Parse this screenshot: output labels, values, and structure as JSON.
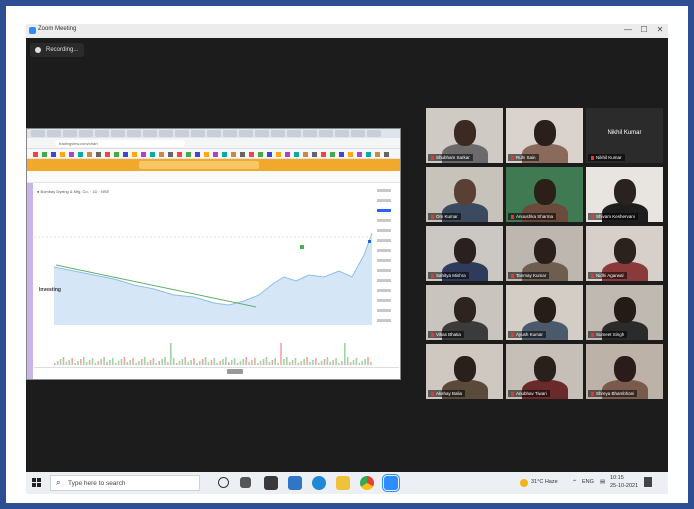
{
  "window": {
    "title": "Zoom Meeting",
    "min": "—",
    "max": "☐",
    "close": "✕"
  },
  "recording": {
    "label": "Recording..."
  },
  "share": {
    "url": "tradingview.com/chart",
    "symbol": "● Bombay Dyeing & Mfg. Co. · 1D · NSE",
    "watermark": "Investing"
  },
  "participants": [
    {
      "name": "Shubham Sarkar",
      "head": "#3a2a22",
      "bg": "#cfcac4",
      "body": "#6b6b6b"
    },
    {
      "name": "Ruhi Sain",
      "head": "#2a1f1a",
      "bg": "#d9d2cd",
      "body": "#8a6a5a"
    },
    {
      "name": "Nikhil Kumar",
      "head": "",
      "bg": "#2b2b2b",
      "body": "",
      "big": "Nikhil Kumar"
    },
    {
      "name": "Om Kumar",
      "head": "#5a4034",
      "bg": "#c7c3bb",
      "body": "#3b4a5e",
      "active": true
    },
    {
      "name": "Anoushka Sharma",
      "head": "#2a2018",
      "bg": "#3f7a52",
      "body": "#6a4b3b"
    },
    {
      "name": "Shivam Keshervani",
      "head": "#2a2220",
      "bg": "#e8e4df",
      "body": "#1e1e1e"
    },
    {
      "name": "Sahitya Mishra",
      "head": "#2b2020",
      "bg": "#cbc7c3",
      "body": "#2f3b5a"
    },
    {
      "name": "Tanmay Kumar",
      "head": "#2a1f1a",
      "bg": "#bdb7b0",
      "body": "#6e5e50"
    },
    {
      "name": "Nidhi Agarwal",
      "head": "#2b211d",
      "bg": "#d6cfca",
      "body": "#8a3a3a"
    },
    {
      "name": "Vikas Bhatia",
      "head": "#2d2420",
      "bg": "#c9c4bd",
      "body": "#3b3b3b"
    },
    {
      "name": "Ayush Kumar",
      "head": "#261d19",
      "bg": "#d4cdc6",
      "body": "#4b5a6a"
    },
    {
      "name": "Sumeet Singh",
      "head": "#241a16",
      "bg": "#bfb9b1",
      "body": "#2b2b2b"
    },
    {
      "name": "Akshay Balia",
      "head": "#2a201b",
      "bg": "#cec8c1",
      "body": "#5a4a3a"
    },
    {
      "name": "Anubhav Tiwari",
      "head": "#2a201b",
      "bg": "#c5bfb8",
      "body": "#6a2a2a"
    },
    {
      "name": "Shreya Bhambhani",
      "head": "#2a1c18",
      "bg": "#bcb2a8",
      "body": "#7a5a4a"
    }
  ],
  "taskbar": {
    "search_placeholder": "Type here to search",
    "weather": "31°C Haze",
    "lang": "ENG",
    "time": "10:15",
    "date": "25-10-2021"
  }
}
